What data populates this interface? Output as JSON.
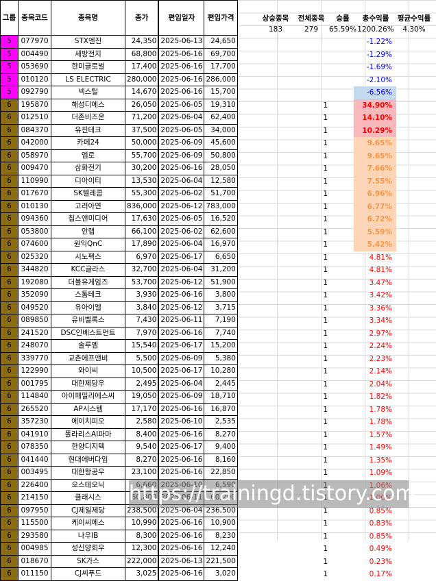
{
  "table": {
    "headers": {
      "group": "그룹",
      "code": "종목코드",
      "name": "종목명",
      "price": "종가",
      "date": "편입일자",
      "entry": "편입가격"
    },
    "rows": [
      {
        "group": "5",
        "code": "077970",
        "name": "STX엔진",
        "price": "24,350",
        "date": "2025-06-13",
        "entry": "24,650",
        "up": "",
        "ret": "-1.22%"
      },
      {
        "group": "5",
        "code": "004490",
        "name": "세방전지",
        "price": "68,800",
        "date": "2025-06-16",
        "entry": "69,700",
        "up": "",
        "ret": "-1.29%"
      },
      {
        "group": "5",
        "code": "053690",
        "name": "한미글로벌",
        "price": "17,400",
        "date": "2025-06-16",
        "entry": "17,700",
        "up": "",
        "ret": "-1.69%"
      },
      {
        "group": "5",
        "code": "010120",
        "name": "LS ELECTRIC",
        "price": "280,000",
        "date": "2025-06-16",
        "entry": "286,000",
        "up": "",
        "ret": "-2.10%"
      },
      {
        "group": "5",
        "code": "092790",
        "name": "넥스틸",
        "price": "14,670",
        "date": "2025-06-16",
        "entry": "15,700",
        "up": "",
        "ret": "-6.56%"
      },
      {
        "group": "6",
        "code": "195870",
        "name": "해성디에스",
        "price": "26,050",
        "date": "2025-06-05",
        "entry": "19,310",
        "up": "1",
        "ret": "34.90%"
      },
      {
        "group": "6",
        "code": "012510",
        "name": "더존비즈온",
        "price": "71,200",
        "date": "2025-06-04",
        "entry": "62,400",
        "up": "1",
        "ret": "14.10%"
      },
      {
        "group": "6",
        "code": "084370",
        "name": "유진테크",
        "price": "37,500",
        "date": "2025-06-05",
        "entry": "34,000",
        "up": "1",
        "ret": "10.29%"
      },
      {
        "group": "6",
        "code": "042000",
        "name": "카페24",
        "price": "50,000",
        "date": "2025-06-09",
        "entry": "45,600",
        "up": "1",
        "ret": "9.65%"
      },
      {
        "group": "6",
        "code": "058970",
        "name": "엠로",
        "price": "55,700",
        "date": "2025-06-09",
        "entry": "50,800",
        "up": "1",
        "ret": "9.65%"
      },
      {
        "group": "6",
        "code": "009470",
        "name": "삼화전기",
        "price": "30,200",
        "date": "2025-06-16",
        "entry": "28,050",
        "up": "1",
        "ret": "7.66%"
      },
      {
        "group": "6",
        "code": "110990",
        "name": "디아이티",
        "price": "13,530",
        "date": "2025-06-04",
        "entry": "12,580",
        "up": "1",
        "ret": "7.55%"
      },
      {
        "group": "6",
        "code": "017670",
        "name": "SK텔레콤",
        "price": "55,300",
        "date": "2025-06-02",
        "entry": "51,700",
        "up": "1",
        "ret": "6.96%"
      },
      {
        "group": "6",
        "code": "010130",
        "name": "고려아연",
        "price": "836,000",
        "date": "2025-06-12",
        "entry": "783,000",
        "up": "1",
        "ret": "6.77%"
      },
      {
        "group": "6",
        "code": "094360",
        "name": "칩스앤미디어",
        "price": "17,630",
        "date": "2025-06-05",
        "entry": "16,520",
        "up": "1",
        "ret": "6.72%"
      },
      {
        "group": "6",
        "code": "053800",
        "name": "안랩",
        "price": "66,100",
        "date": "2025-06-02",
        "entry": "62,600",
        "up": "1",
        "ret": "5.59%"
      },
      {
        "group": "6",
        "code": "074600",
        "name": "원익QnC",
        "price": "17,890",
        "date": "2025-06-04",
        "entry": "16,970",
        "up": "1",
        "ret": "5.42%"
      },
      {
        "group": "6",
        "code": "025320",
        "name": "시노펙스",
        "price": "6,970",
        "date": "2025-06-17",
        "entry": "6,650",
        "up": "1",
        "ret": "4.81%"
      },
      {
        "group": "6",
        "code": "344820",
        "name": "KCC글라스",
        "price": "32,700",
        "date": "2025-06-04",
        "entry": "31,200",
        "up": "1",
        "ret": "4.81%"
      },
      {
        "group": "6",
        "code": "192080",
        "name": "더블유게임즈",
        "price": "53,700",
        "date": "2025-06-12",
        "entry": "51,900",
        "up": "1",
        "ret": "3.47%"
      },
      {
        "group": "6",
        "code": "352090",
        "name": "스톰테크",
        "price": "3,930",
        "date": "2025-06-16",
        "entry": "3,800",
        "up": "1",
        "ret": "3.42%"
      },
      {
        "group": "6",
        "code": "049520",
        "name": "유아이엘",
        "price": "3,840",
        "date": "2025-06-12",
        "entry": "3,715",
        "up": "1",
        "ret": "3.36%"
      },
      {
        "group": "6",
        "code": "089850",
        "name": "유비벨록스",
        "price": "7,430",
        "date": "2025-06-11",
        "entry": "7,190",
        "up": "1",
        "ret": "3.34%"
      },
      {
        "group": "6",
        "code": "241520",
        "name": "DSC인베스트먼트",
        "price": "7,970",
        "date": "2025-06-16",
        "entry": "7,740",
        "up": "1",
        "ret": "2.97%"
      },
      {
        "group": "6",
        "code": "248070",
        "name": "솔루엠",
        "price": "15,540",
        "date": "2025-06-17",
        "entry": "15,200",
        "up": "1",
        "ret": "2.24%"
      },
      {
        "group": "6",
        "code": "339770",
        "name": "교촌에프앤비",
        "price": "5,500",
        "date": "2025-06-09",
        "entry": "5,380",
        "up": "1",
        "ret": "2.23%"
      },
      {
        "group": "6",
        "code": "122990",
        "name": "와이씨",
        "price": "10,500",
        "date": "2025-06-17",
        "entry": "10,280",
        "up": "1",
        "ret": "2.14%"
      },
      {
        "group": "6",
        "code": "001795",
        "name": "대한제당우",
        "price": "2,495",
        "date": "2025-06-04",
        "entry": "2,445",
        "up": "1",
        "ret": "2.04%"
      },
      {
        "group": "6",
        "code": "114840",
        "name": "아이패밀리에스씨",
        "price": "19,050",
        "date": "2025-06-09",
        "entry": "18,710",
        "up": "1",
        "ret": "1.82%"
      },
      {
        "group": "6",
        "code": "265520",
        "name": "AP시스템",
        "price": "17,170",
        "date": "2025-06-16",
        "entry": "16,870",
        "up": "1",
        "ret": "1.78%"
      },
      {
        "group": "6",
        "code": "357230",
        "name": "에이치피오",
        "price": "2,580",
        "date": "2025-06-10",
        "entry": "2,535",
        "up": "1",
        "ret": "1.78%"
      },
      {
        "group": "6",
        "code": "041910",
        "name": "폴라리스AI파마",
        "price": "8,400",
        "date": "2025-06-16",
        "entry": "8,270",
        "up": "1",
        "ret": "1.57%"
      },
      {
        "group": "6",
        "code": "078350",
        "name": "한양디지텍",
        "price": "9,540",
        "date": "2025-06-17",
        "entry": "9,400",
        "up": "1",
        "ret": "1.49%"
      },
      {
        "group": "6",
        "code": "041440",
        "name": "현대에버다임",
        "price": "8,270",
        "date": "2025-06-16",
        "entry": "8,160",
        "up": "1",
        "ret": "1.35%"
      },
      {
        "group": "6",
        "code": "003495",
        "name": "대한항공우",
        "price": "23,100",
        "date": "2025-06-16",
        "entry": "22,850",
        "up": "1",
        "ret": "1.09%"
      },
      {
        "group": "6",
        "code": "226400",
        "name": "오스테오닉",
        "price": "6,660",
        "date": "2025-06-10",
        "entry": "6,590",
        "up": "1",
        "ret": "1.06%"
      },
      {
        "group": "6",
        "code": "214150",
        "name": "클래시스",
        "price": "60,800",
        "date": "2025-06-11",
        "entry": "60,200",
        "up": "1",
        "ret": "1.00%"
      },
      {
        "group": "6",
        "code": "097950",
        "name": "CJ제일제당",
        "price": "238,500",
        "date": "2025-06-04",
        "entry": "236,500",
        "up": "1",
        "ret": "0.85%"
      },
      {
        "group": "6",
        "code": "115500",
        "name": "케이씨에스",
        "price": "10,990",
        "date": "2025-06-16",
        "entry": "10,900",
        "up": "1",
        "ret": "0.83%"
      },
      {
        "group": "6",
        "code": "293580",
        "name": "나우IB",
        "price": "8,300",
        "date": "2025-06-16",
        "entry": "8,230",
        "up": "1",
        "ret": "0.85%"
      },
      {
        "group": "6",
        "code": "004985",
        "name": "성신양회우",
        "price": "12,300",
        "date": "2025-06-16",
        "entry": "12,240",
        "up": "1",
        "ret": "0.49%"
      },
      {
        "group": "6",
        "code": "018670",
        "name": "SK가스",
        "price": "222,000",
        "date": "2025-06-13",
        "entry": "221,500",
        "up": "1",
        "ret": "0.23%"
      },
      {
        "group": "6",
        "code": "011150",
        "name": "CJ씨푸드",
        "price": "3,025",
        "date": "2025-06-16",
        "entry": "3,020",
        "up": "1",
        "ret": "0.17%"
      }
    ]
  },
  "summary": {
    "headers": [
      "상승종목",
      "전체종목",
      "승률",
      "총수익률",
      "평균수익률"
    ],
    "values": [
      "183",
      "279",
      "65.59%",
      "1200.26%",
      "4.30%"
    ]
  },
  "watermark": {
    "text": "https://trainingd.tistory.com"
  },
  "colors": {
    "group5": "#ff00ff",
    "group6": "#8b6b14",
    "negative": "#0000ff",
    "positive": "#ff0000"
  }
}
